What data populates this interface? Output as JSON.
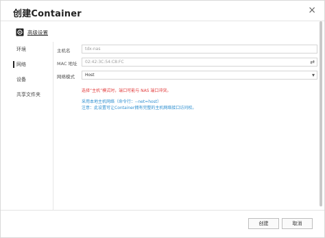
{
  "dialog": {
    "title": "创建Container",
    "close_symbol": "×"
  },
  "advanced": {
    "label": "高级设置",
    "icon": "gear-icon"
  },
  "nav": {
    "items": [
      {
        "label": "环境"
      },
      {
        "label": "网络"
      },
      {
        "label": "设备"
      },
      {
        "label": "共享文件夹"
      }
    ],
    "active_index": 1
  },
  "form": {
    "hostname_label": "主机名",
    "hostname_value": "tdx-nas",
    "mac_label": "MAC 地址",
    "mac_value": "02:42:3C:54:C8:FC",
    "netmode_label": "网络模式",
    "netmode_value": "Host",
    "shuffle_icon": "shuffle-icon",
    "dropdown_icon": "chevron-down-icon"
  },
  "messages": {
    "warning": "选择“主机”模式时，端口可能与 NAS 端口冲突。",
    "info_line1": "采用本地主机网络（命令行：--net=host）",
    "info_line2": "注意：此设置可让Container拥有完整的主机网络接口访问权。"
  },
  "buttons": {
    "create": "创建",
    "cancel": "取消"
  },
  "colors": {
    "warning": "#e23c3c",
    "info": "#2e8fd0"
  }
}
